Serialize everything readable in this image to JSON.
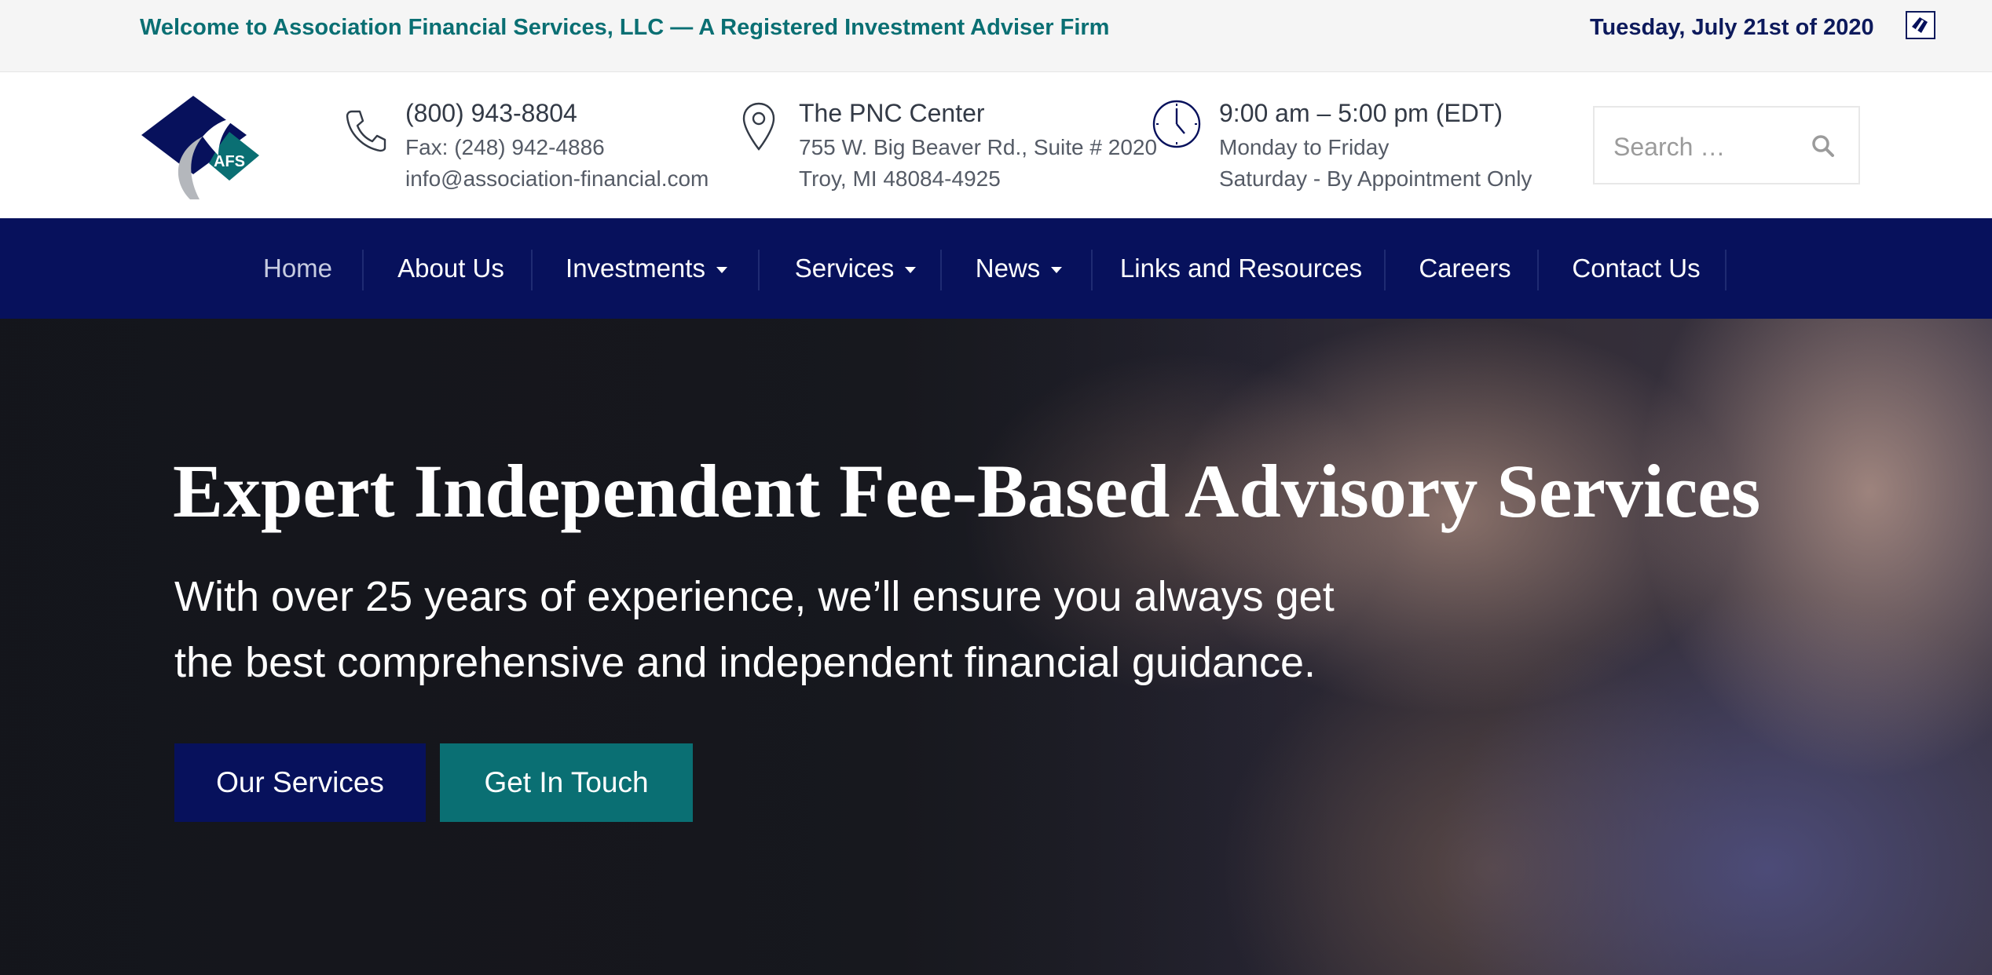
{
  "topbar": {
    "welcome": "Welcome to Association Financial Services, LLC — A Registered Investment Adviser Firm",
    "date": "Tuesday, July 21st of 2020"
  },
  "header": {
    "phone": {
      "number": "(800) 943-8804",
      "fax": "Fax: (248) 942-4886",
      "email": "info@association-financial.com"
    },
    "location": {
      "name": "The PNC Center",
      "street": "755 W. Big Beaver Rd., Suite # 2020",
      "city": "Troy, MI 48084-4925"
    },
    "hours": {
      "time": "9:00 am – 5:00 pm (EDT)",
      "weekdays": "Monday to Friday",
      "saturday": "Saturday - By Appointment Only"
    },
    "search": {
      "placeholder": "Search …"
    },
    "logo_text": "AFS"
  },
  "nav": {
    "items": [
      {
        "label": "Home",
        "active": true,
        "dropdown": false
      },
      {
        "label": "About Us",
        "dropdown": false
      },
      {
        "label": "Investments",
        "dropdown": true
      },
      {
        "label": "Services",
        "dropdown": true
      },
      {
        "label": "News",
        "dropdown": true
      },
      {
        "label": "Links and Resources",
        "dropdown": false
      },
      {
        "label": "Careers",
        "dropdown": false
      },
      {
        "label": "Contact Us",
        "dropdown": false
      }
    ]
  },
  "hero": {
    "title": "Expert Independent Fee-Based Advisory Services",
    "subtitle": "With over 25 years of experience, we’ll ensure you always get the best comprehensive and independent financial guidance.",
    "buttons": {
      "services": "Our Services",
      "touch": "Get In Touch"
    }
  },
  "colors": {
    "navy": "#07115c",
    "teal": "#0a6f73",
    "topbar_bg": "#f5f5f5"
  }
}
